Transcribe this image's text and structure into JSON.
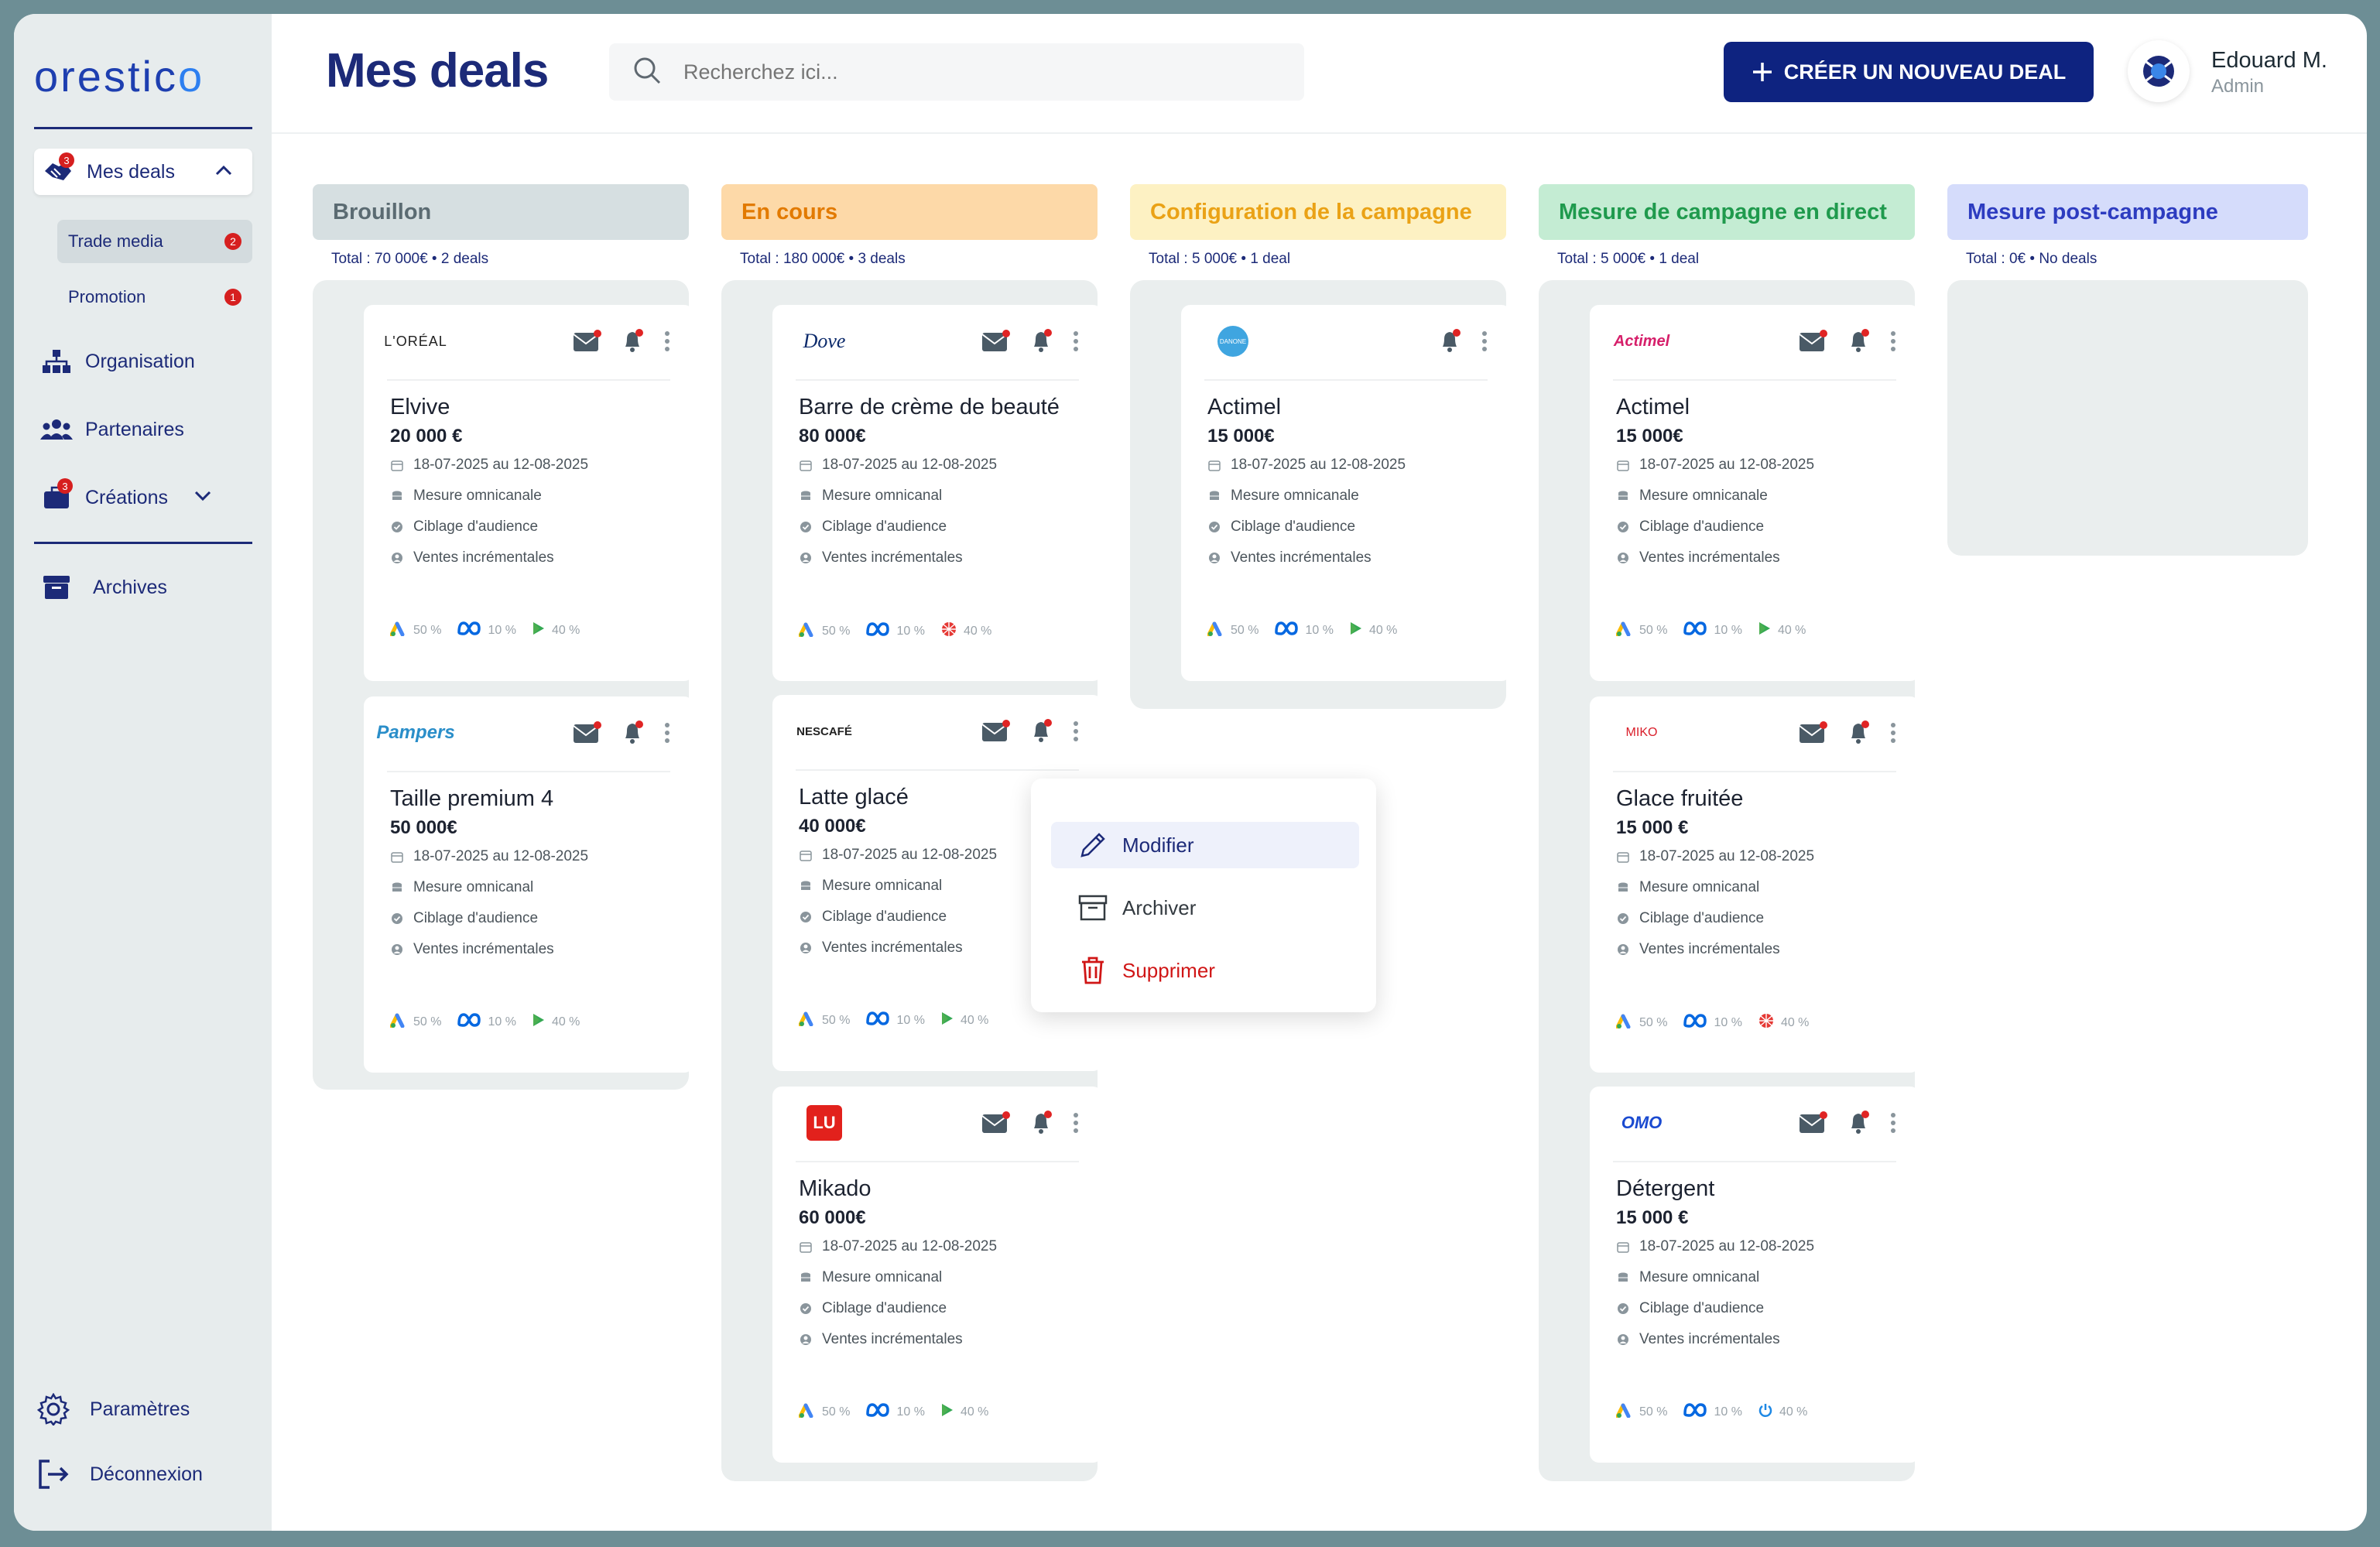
{
  "app": {
    "logo": "orestico",
    "logo_a": "orestic",
    "logo_b": "o"
  },
  "sidebar": {
    "mes_deals": {
      "label": "Mes deals",
      "badge": "3"
    },
    "sub_items": [
      {
        "label": "Trade media",
        "badge": "2"
      },
      {
        "label": "Promotion",
        "badge": "1"
      }
    ],
    "organisation": "Organisation",
    "partenaires": "Partenaires",
    "creations": {
      "label": "Créations",
      "badge": "3"
    },
    "archives": "Archives",
    "parametres": "Paramètres",
    "deconnexion": "Déconnexion"
  },
  "header": {
    "title": "Mes deals",
    "search_placeholder": "Recherchez ici...",
    "create_button": "CRÉER UN NOUVEAU DEAL",
    "user_name": "Edouard M.",
    "user_role": "Admin"
  },
  "columns": [
    {
      "title": "Brouillon",
      "total": "Total : 70 000€",
      "count": "2 deals",
      "color": "#5b6b72",
      "bg": "#d6dfe1"
    },
    {
      "title": "En cours",
      "total": "Total : 180 000€",
      "count": "3 deals",
      "color": "#e27a00",
      "bg": "#fdd9a8"
    },
    {
      "title": "Configuration de la campagne",
      "total": "Total : 5 000€",
      "count": "1 deal",
      "color": "#eaa216",
      "bg": "#fdf1c3"
    },
    {
      "title": "Mesure de campagne en direct",
      "total": "Total : 5 000€",
      "count": "1 deal",
      "color": "#1f9a4d",
      "bg": "#c4ecd3"
    },
    {
      "title": "Mesure post-campagne",
      "total": "Total : 0€",
      "count": "No deals",
      "color": "#2d3cc0",
      "bg": "#d5dcfb"
    }
  ],
  "cards": [
    {
      "brand": "L'ORÉAL",
      "title": "Elvive",
      "amount": "20 000 €",
      "date": "18-07-2025 au 12-08-2025",
      "l1": "Mesure omnicanale",
      "l2": "Ciblage d'audience",
      "l3": "Ventes incrémentales",
      "c1": "50 %",
      "c2": "10 %",
      "c3": "40 %"
    },
    {
      "brand": "Pampers",
      "title": "Taille premium 4",
      "amount": "50 000€",
      "date": "18-07-2025 au 12-08-2025",
      "l1": "Mesure omnicanal",
      "l2": "Ciblage d'audience",
      "l3": "Ventes incrémentales",
      "c1": "50 %",
      "c2": "10 %",
      "c3": "40 %"
    },
    {
      "brand": "Dove",
      "title": "Barre de crème de beauté",
      "amount": "80 000€",
      "date": "18-07-2025 au 12-08-2025",
      "l1": "Mesure omnicanal",
      "l2": "Ciblage d'audience",
      "l3": "Ventes incrémentales",
      "c1": "50 %",
      "c2": "10 %",
      "c3": "40 %"
    },
    {
      "brand": "NESCAFÉ",
      "title": "Latte glacé",
      "amount": "40 000€",
      "date": "18-07-2025 au 12-08-2025",
      "l1": "Mesure omnicanal",
      "l2": "Ciblage d'audience",
      "l3": "Ventes incrémentales",
      "c1": "50 %",
      "c2": "10 %",
      "c3": "40 %"
    },
    {
      "brand": "LU",
      "title": "Mikado",
      "amount": "60 000€",
      "date": "18-07-2025 au 12-08-2025",
      "l1": "Mesure omnicanal",
      "l2": "Ciblage d'audience",
      "l3": "Ventes incrémentales",
      "c1": "50 %",
      "c2": "10 %",
      "c3": "40 %"
    },
    {
      "brand": "DANONE",
      "title": "Actimel",
      "amount": "15 000€",
      "date": "18-07-2025 au 12-08-2025",
      "l1": "Mesure omnicanale",
      "l2": "Ciblage d'audience",
      "l3": "Ventes incrémentales",
      "c1": "50 %",
      "c2": "10 %",
      "c3": "40 %"
    },
    {
      "brand": "Actimel",
      "title": "Actimel",
      "amount": "15 000€",
      "date": "18-07-2025 au 12-08-2025",
      "l1": "Mesure omnicanale",
      "l2": "Ciblage d'audience",
      "l3": "Ventes incrémentales",
      "c1": "50 %",
      "c2": "10 %",
      "c3": "40 %"
    },
    {
      "brand": "MIKO",
      "title": "Glace fruitée",
      "amount": "15 000 €",
      "date": "18-07-2025 au 12-08-2025",
      "l1": "Mesure omnicanal",
      "l2": "Ciblage d'audience",
      "l3": "Ventes incrémentales",
      "c1": "50 %",
      "c2": "10 %",
      "c3": "40 %"
    },
    {
      "brand": "OMO",
      "title": "Détergent",
      "amount": "15 000 €",
      "date": "18-07-2025 au 12-08-2025",
      "l1": "Mesure omnicanal",
      "l2": "Ciblage d'audience",
      "l3": "Ventes incrémentales",
      "c1": "50 %",
      "c2": "10 %",
      "c3": "40 %"
    }
  ],
  "menu": {
    "modifier": "Modifier",
    "archiver": "Archiver",
    "supprimer": "Supprimer"
  }
}
